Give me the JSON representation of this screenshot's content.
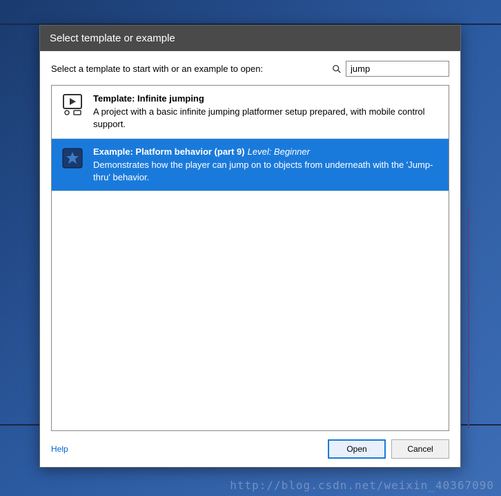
{
  "dialog": {
    "title": "Select template or example",
    "prompt": "Select a template to start with or an example to open:",
    "search_value": "jump",
    "help_label": "Help",
    "open_label": "Open",
    "cancel_label": "Cancel"
  },
  "items": [
    {
      "title": "Template: Infinite jumping",
      "level": "",
      "desc": "A project with a basic infinite jumping platformer setup prepared, with mobile control support.",
      "selected": false,
      "icon": "play"
    },
    {
      "title": "Example: Platform behavior (part 9)",
      "level": "Level: Beginner",
      "desc": "Demonstrates how the player can jump on to objects from underneath with the 'Jump-thru' behavior.",
      "selected": true,
      "icon": "star"
    }
  ],
  "watermark": "http://blog.csdn.net/weixin_40367090"
}
